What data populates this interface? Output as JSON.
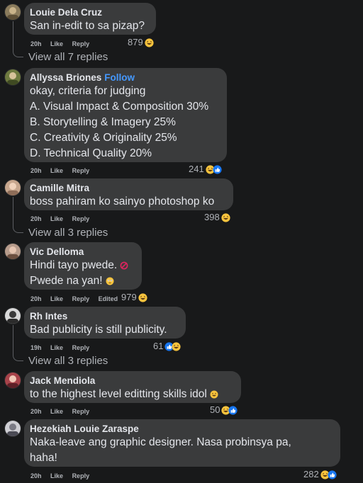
{
  "comments": [
    {
      "author": "Louie Dela Cruz",
      "follow": "",
      "lines": [
        "San in-edit to sa pizap?"
      ],
      "time": "20h",
      "like": "Like",
      "reply": "Reply",
      "edited": "",
      "reaction_count": "879",
      "reactions": [
        "haha-icon"
      ],
      "view_replies": "View all 7 replies"
    },
    {
      "author": "Allyssa Briones",
      "follow": "Follow",
      "lines": [
        "okay, criteria for judging",
        "A. Visual Impact & Composition 30%",
        "B. Storytelling & Imagery 25%",
        "C. Creativity & Originality 25%",
        "D. Technical Quality 20%"
      ],
      "time": "20h",
      "like": "Like",
      "reply": "Reply",
      "edited": "",
      "reaction_count": "241",
      "reactions": [
        "haha-icon",
        "like-icon"
      ],
      "view_replies": ""
    },
    {
      "author": "Camille Mitra",
      "follow": "",
      "lines": [
        "boss pahiram ko sainyo photoshop ko"
      ],
      "time": "20h",
      "like": "Like",
      "reply": "Reply",
      "edited": "",
      "reaction_count": "398",
      "reactions": [
        "haha-icon"
      ],
      "view_replies": "View all 3 replies"
    },
    {
      "author": "Vic Delloma",
      "follow": "",
      "lines": [
        "Hindi tayo pwede.",
        "Pwede na yan!"
      ],
      "time": "20h",
      "like": "Like",
      "reply": "Reply",
      "edited": "Edited",
      "reaction_count": "979",
      "reactions": [
        "haha-icon"
      ],
      "view_replies": ""
    },
    {
      "author": "Rh Intes",
      "follow": "",
      "lines": [
        "Bad publicity is still publicity."
      ],
      "time": "19h",
      "like": "Like",
      "reply": "Reply",
      "edited": "",
      "reaction_count": "61",
      "reactions": [
        "like-icon",
        "haha-icon"
      ],
      "view_replies": "View all 3 replies"
    },
    {
      "author": "Jack Mendiola",
      "follow": "",
      "lines": [
        "to the highest level editting skills idol"
      ],
      "time": "20h",
      "like": "Like",
      "reply": "Reply",
      "edited": "",
      "reaction_count": "50",
      "reactions": [
        "haha-icon",
        "like-icon"
      ],
      "view_replies": ""
    },
    {
      "author": "Hezekiah Louie Zaraspe",
      "follow": "",
      "lines": [
        "Naka-leave ang graphic designer. Nasa probinsya pa,",
        "haha!"
      ],
      "time": "20h",
      "like": "Like",
      "reply": "Reply",
      "edited": "",
      "reaction_count": "282",
      "reactions": [
        "haha-icon",
        "like-icon"
      ],
      "view_replies": ""
    }
  ],
  "colors": {
    "background": "#18191a",
    "bubble": "#3a3b3c",
    "text": "#e4e6eb",
    "muted": "#b0b3b8",
    "follow": "#4599ff",
    "like_blue": "#1877f2",
    "haha_yellow": "#f7c33d"
  }
}
